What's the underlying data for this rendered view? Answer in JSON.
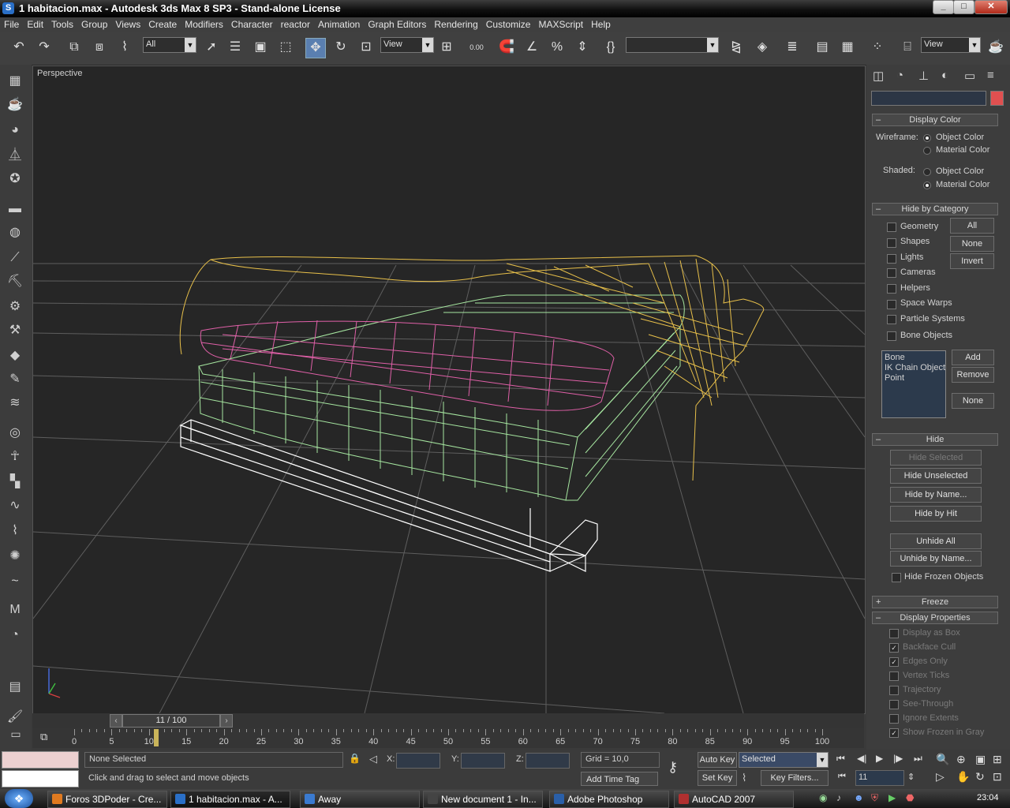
{
  "window": {
    "title": "1 habitacion.max - Autodesk 3ds Max 8 SP3  - Stand-alone License"
  },
  "menu": [
    "File",
    "Edit",
    "Tools",
    "Group",
    "Views",
    "Create",
    "Modifiers",
    "Character",
    "reactor",
    "Animation",
    "Graph Editors",
    "Rendering",
    "Customize",
    "MAXScript",
    "Help"
  ],
  "toolbar": {
    "selection_filter": "All",
    "ref_coord": "View",
    "snap_value": "0.00",
    "named_sel": "",
    "render_view": "View"
  },
  "viewport": {
    "label": "Perspective",
    "colors": {
      "background": "#262626",
      "grid": "#5e5e5e",
      "blanket": "#e8c04a",
      "mattress": "#a6e6a0",
      "pillow": "#e060a8",
      "frame": "#ffffff"
    }
  },
  "display_panel": {
    "color_swatch": "#e05050",
    "display_color": {
      "header": "Display Color",
      "wireframe_label": "Wireframe:",
      "shaded_label": "Shaded:",
      "options": [
        "Object Color",
        "Material Color"
      ],
      "wireframe_selected": "Object Color",
      "shaded_selected": "Material Color"
    },
    "hide_by_category": {
      "header": "Hide by Category",
      "items": [
        "Geometry",
        "Shapes",
        "Lights",
        "Cameras",
        "Helpers",
        "Space Warps",
        "Particle Systems",
        "Bone Objects"
      ],
      "buttons": {
        "all": "All",
        "none": "None",
        "invert": "Invert"
      },
      "list": [
        "Bone",
        "IK Chain Object",
        "Point"
      ],
      "list_buttons": {
        "add": "Add",
        "remove": "Remove",
        "none": "None"
      }
    },
    "hide": {
      "header": "Hide",
      "buttons": [
        "Hide Selected",
        "Hide Unselected",
        "Hide by Name...",
        "Hide by Hit",
        "Unhide All",
        "Unhide by Name..."
      ],
      "hide_frozen": "Hide Frozen Objects"
    },
    "freeze": {
      "header": "Freeze"
    },
    "display_properties": {
      "header": "Display Properties",
      "items": [
        {
          "label": "Display as Box",
          "checked": false
        },
        {
          "label": "Backface Cull",
          "checked": true
        },
        {
          "label": "Edges Only",
          "checked": true
        },
        {
          "label": "Vertex Ticks",
          "checked": false
        },
        {
          "label": "Trajectory",
          "checked": false
        },
        {
          "label": "See-Through",
          "checked": false
        },
        {
          "label": "Ignore Extents",
          "checked": false
        },
        {
          "label": "Show Frozen in Gray",
          "checked": true
        }
      ]
    }
  },
  "timeline": {
    "frame_display": "11 / 100",
    "current_frame": 11,
    "total_frames": 100,
    "tick_labels": [
      "0",
      "5",
      "10",
      "15",
      "20",
      "25",
      "30",
      "35",
      "40",
      "45",
      "50",
      "55",
      "60",
      "65",
      "70",
      "75",
      "80",
      "85",
      "90",
      "95",
      "100"
    ]
  },
  "status": {
    "selection": "None Selected",
    "prompt": "Click and drag to select and move objects",
    "x_label": "X:",
    "y_label": "Y:",
    "z_label": "Z:",
    "grid": "Grid = 10,0",
    "add_time_tag": "Add Time Tag",
    "auto_key": "Auto Key",
    "set_key": "Set Key",
    "key_mode": "Selected",
    "key_filters": "Key Filters...",
    "frame": "11"
  },
  "taskbar": {
    "tasks": [
      {
        "label": "Foros 3DPoder - Cre...",
        "color": "#e07a20"
      },
      {
        "label": "1 habitacion.max - A...",
        "color": "#2a6fc7"
      },
      {
        "label": "Away",
        "color": "#3a7ad0"
      },
      {
        "label": "New document 1 - In...",
        "color": "#444444"
      },
      {
        "label": "Adobe Photoshop",
        "color": "#2a5fa8"
      },
      {
        "label": "AutoCAD 2007",
        "color": "#b03030"
      }
    ],
    "clock": "23:04"
  }
}
